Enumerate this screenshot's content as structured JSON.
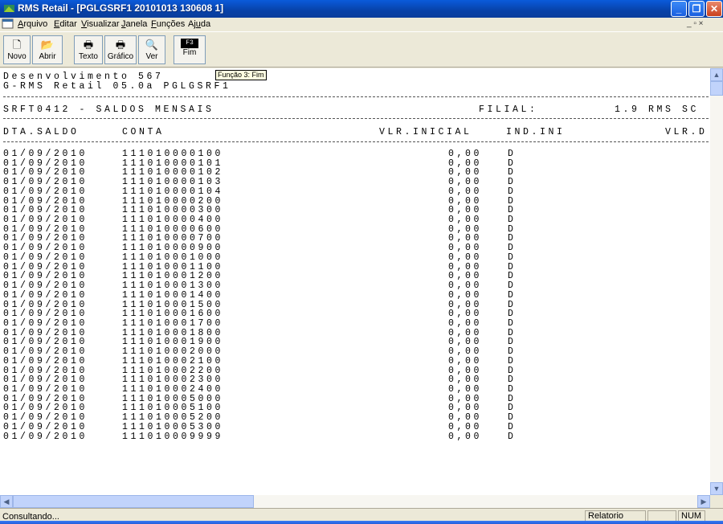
{
  "window": {
    "title": "RMS Retail - [PGLGSRF1 20101013 130608 1]",
    "minimize_glyph": "_",
    "maximize_glyph": "❐",
    "close_glyph": "✕"
  },
  "menu": {
    "items": [
      {
        "accel": "A",
        "rest": "rquivo"
      },
      {
        "accel": "E",
        "rest": "ditar"
      },
      {
        "accel": "V",
        "rest": "isualizar"
      },
      {
        "accel": "J",
        "rest": "anela"
      },
      {
        "accel": "F",
        "rest": "unções"
      },
      {
        "pre": "Aj",
        "accel": "u",
        "rest": "da"
      }
    ],
    "mdi_controls": "_ ▫ ×"
  },
  "toolbar": {
    "buttons": [
      {
        "label": "Novo",
        "icon": "new-document-icon",
        "glyph": "🗋"
      },
      {
        "label": "Abrir",
        "icon": "open-folder-icon",
        "glyph": "📂"
      },
      {
        "label": "Texto",
        "icon": "print-text-icon",
        "glyph": "🖶"
      },
      {
        "label": "Gráfico",
        "icon": "print-graphic-icon",
        "glyph": "🖶"
      },
      {
        "label": "Ver",
        "icon": "preview-icon",
        "glyph": "🔍"
      },
      {
        "label": "Fim",
        "icon": "f3-key-icon",
        "key": "F3"
      }
    ],
    "tooltip": "Função 3: Fim"
  },
  "report": {
    "header_line1": "Desenvolvimento 567",
    "header_line2": "G-RMS Retail 05.0a PGLGSRF1",
    "program_title": "SRFT0412 - SALDOS MENSAIS",
    "filial_label": "FILIAL:",
    "filial_value": "1.9 RMS SC",
    "columns": {
      "dta_saldo": "DTA.SALDO",
      "conta": "CONTA",
      "vlr_inicial": "VLR.INICIAL",
      "ind_ini": "IND.INI",
      "vlr_d": "VLR.D"
    },
    "rows": [
      {
        "date": "01/09/2010",
        "conta": "111010000100",
        "vlr": "0,00",
        "ind": "D"
      },
      {
        "date": "01/09/2010",
        "conta": "111010000101",
        "vlr": "0,00",
        "ind": "D"
      },
      {
        "date": "01/09/2010",
        "conta": "111010000102",
        "vlr": "0,00",
        "ind": "D"
      },
      {
        "date": "01/09/2010",
        "conta": "111010000103",
        "vlr": "0,00",
        "ind": "D"
      },
      {
        "date": "01/09/2010",
        "conta": "111010000104",
        "vlr": "0,00",
        "ind": "D"
      },
      {
        "date": "01/09/2010",
        "conta": "111010000200",
        "vlr": "0,00",
        "ind": "D"
      },
      {
        "date": "01/09/2010",
        "conta": "111010000300",
        "vlr": "0,00",
        "ind": "D"
      },
      {
        "date": "01/09/2010",
        "conta": "111010000400",
        "vlr": "0,00",
        "ind": "D"
      },
      {
        "date": "01/09/2010",
        "conta": "111010000600",
        "vlr": "0,00",
        "ind": "D"
      },
      {
        "date": "01/09/2010",
        "conta": "111010000700",
        "vlr": "0,00",
        "ind": "D"
      },
      {
        "date": "01/09/2010",
        "conta": "111010000900",
        "vlr": "0,00",
        "ind": "D"
      },
      {
        "date": "01/09/2010",
        "conta": "111010001000",
        "vlr": "0,00",
        "ind": "D"
      },
      {
        "date": "01/09/2010",
        "conta": "111010001100",
        "vlr": "0,00",
        "ind": "D"
      },
      {
        "date": "01/09/2010",
        "conta": "111010001200",
        "vlr": "0,00",
        "ind": "D"
      },
      {
        "date": "01/09/2010",
        "conta": "111010001300",
        "vlr": "0,00",
        "ind": "D"
      },
      {
        "date": "01/09/2010",
        "conta": "111010001400",
        "vlr": "0,00",
        "ind": "D"
      },
      {
        "date": "01/09/2010",
        "conta": "111010001500",
        "vlr": "0,00",
        "ind": "D"
      },
      {
        "date": "01/09/2010",
        "conta": "111010001600",
        "vlr": "0,00",
        "ind": "D"
      },
      {
        "date": "01/09/2010",
        "conta": "111010001700",
        "vlr": "0,00",
        "ind": "D"
      },
      {
        "date": "01/09/2010",
        "conta": "111010001800",
        "vlr": "0,00",
        "ind": "D"
      },
      {
        "date": "01/09/2010",
        "conta": "111010001900",
        "vlr": "0,00",
        "ind": "D"
      },
      {
        "date": "01/09/2010",
        "conta": "111010002000",
        "vlr": "0,00",
        "ind": "D"
      },
      {
        "date": "01/09/2010",
        "conta": "111010002100",
        "vlr": "0,00",
        "ind": "D"
      },
      {
        "date": "01/09/2010",
        "conta": "111010002200",
        "vlr": "0,00",
        "ind": "D"
      },
      {
        "date": "01/09/2010",
        "conta": "111010002300",
        "vlr": "0,00",
        "ind": "D"
      },
      {
        "date": "01/09/2010",
        "conta": "111010002400",
        "vlr": "0,00",
        "ind": "D"
      },
      {
        "date": "01/09/2010",
        "conta": "111010005000",
        "vlr": "0,00",
        "ind": "D"
      },
      {
        "date": "01/09/2010",
        "conta": "111010005100",
        "vlr": "0,00",
        "ind": "D"
      },
      {
        "date": "01/09/2010",
        "conta": "111010005200",
        "vlr": "0,00",
        "ind": "D"
      },
      {
        "date": "01/09/2010",
        "conta": "111010005300",
        "vlr": "0,00",
        "ind": "D"
      },
      {
        "date": "01/09/2010",
        "conta": "111010009999",
        "vlr": "0,00",
        "ind": "D"
      }
    ]
  },
  "status": {
    "message": "Consultando...",
    "panel_report": "Relatorio",
    "panel_num": "NUM"
  },
  "colors": {
    "titlebar": "#0A5BDB",
    "window_bg": "#ECE9D8",
    "content_bg": "#FFFFFF"
  }
}
